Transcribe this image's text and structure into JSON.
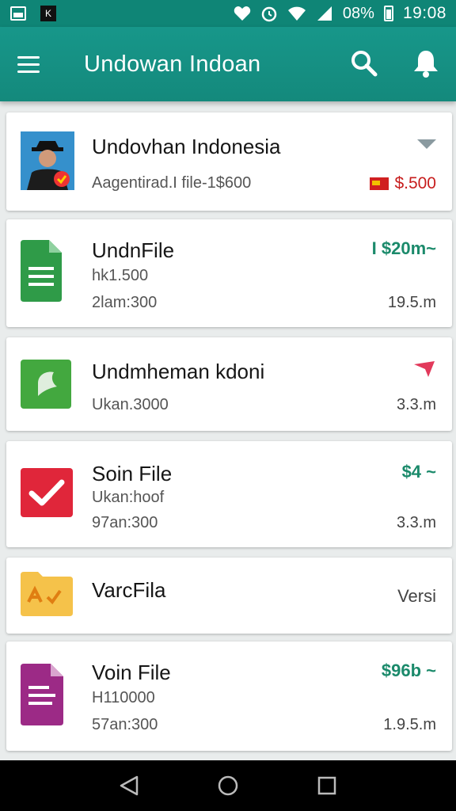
{
  "status_bar": {
    "time": "19:08",
    "battery": "08%",
    "icons": [
      "gallery-icon",
      "notification-icon",
      "heart-icon",
      "alarm-icon",
      "wifi-icon",
      "signal-icon",
      "battery-icon"
    ]
  },
  "app_bar": {
    "title": "Undowan Indoan",
    "icons": [
      "menu-icon",
      "search-icon",
      "bell-icon"
    ]
  },
  "list": {
    "items": [
      {
        "title": "Undovhan Indonesia",
        "subtitle": "Aagentirad.I file-1$600",
        "price": "$.500",
        "price_color": "#c71d1d"
      },
      {
        "title": "UndnFile",
        "subtitle": "hk1.500",
        "meta": "2lam:300",
        "price": "I $20m~",
        "size": "19.5.m"
      },
      {
        "title": "Undmheman kdoni",
        "subtitle": "Ukan.3000",
        "size": "3.3.m"
      },
      {
        "title": "Soin File",
        "subtitle": "Ukan:hoof",
        "meta": "97an:300",
        "price": "$4 ~",
        "size": "3.3.m"
      },
      {
        "title": "VarcFila",
        "right_text": "Versi"
      },
      {
        "title": "Voin File",
        "subtitle": "H110000",
        "meta": "57an:300",
        "price": "$96b ~",
        "size": "1.9.5.m"
      }
    ]
  },
  "colors": {
    "primary": "#14897c",
    "accent_green": "#1b8a6b",
    "accent_red": "#c71d1d"
  },
  "nav": {
    "buttons": [
      "back-icon",
      "home-icon",
      "recents-icon"
    ]
  }
}
